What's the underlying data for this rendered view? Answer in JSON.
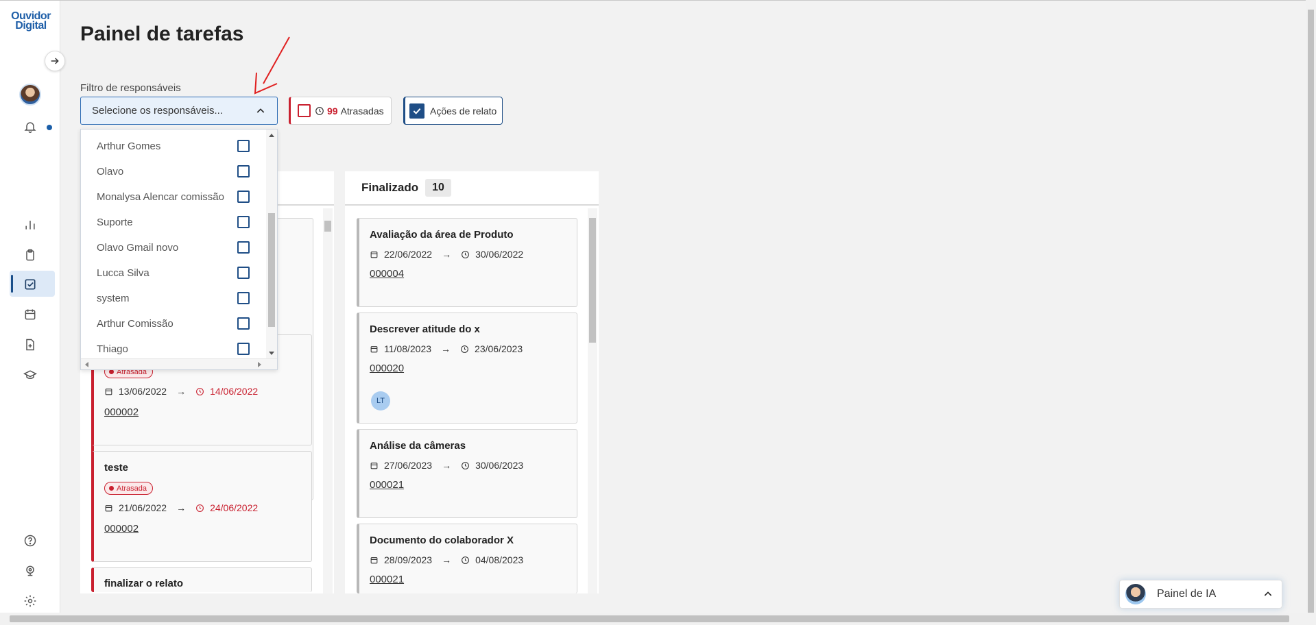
{
  "app": {
    "logo_line1": "Ouvidor",
    "logo_line2": "Digital"
  },
  "header": {
    "title": "Painel de tarefas"
  },
  "filter": {
    "label": "Filtro de responsáveis",
    "select_placeholder": "Selecione os responsáveis...",
    "options": [
      {
        "label": "Arthur Gomes",
        "checked": false
      },
      {
        "label": "Olavo",
        "checked": false
      },
      {
        "label": "Monalysa Alencar comissão",
        "checked": false
      },
      {
        "label": "Suporte",
        "checked": false
      },
      {
        "label": "Olavo Gmail novo",
        "checked": false
      },
      {
        "label": "Lucca Silva",
        "checked": false
      },
      {
        "label": "system",
        "checked": false
      },
      {
        "label": "Arthur Comissão",
        "checked": false
      },
      {
        "label": "Thiago",
        "checked": false
      }
    ]
  },
  "toggles": {
    "late": {
      "count": "99",
      "label": "Atrasadas",
      "checked": false
    },
    "actions": {
      "label": "Ações de relato",
      "checked": true
    }
  },
  "columns": {
    "left": {
      "cards": [
        {
          "badge": "Atrasada",
          "start": "13/06/2022",
          "end": "14/06/2022",
          "code": "000002"
        },
        {
          "title": "teste",
          "badge": "Atrasada",
          "start": "21/06/2022",
          "end": "24/06/2022",
          "code": "000002"
        },
        {
          "title": "finalizar o relato"
        }
      ]
    },
    "finalizado": {
      "title": "Finalizado",
      "count": "10",
      "cards": [
        {
          "title": "Avaliação da área de Produto",
          "start": "22/06/2022",
          "end": "30/06/2022",
          "code": "000004"
        },
        {
          "title": "Descrever atitude do x",
          "start": "11/08/2023",
          "end": "23/06/2023",
          "code": "000020",
          "assignee": "LT"
        },
        {
          "title": "Análise da câmeras",
          "start": "27/06/2023",
          "end": "30/06/2023",
          "code": "000021"
        },
        {
          "title": "Documento do colaborador X",
          "start": "28/09/2023",
          "end": "04/08/2023",
          "code": "000021"
        }
      ]
    }
  },
  "ai_panel": {
    "label": "Painel de IA"
  },
  "colors": {
    "primary": "#1f4e86",
    "danger": "#c9202f",
    "active_bg": "#dde9f7"
  },
  "icons": [
    "arrow-right-icon",
    "bell-icon",
    "chart-icon",
    "clipboard-icon",
    "task-check-icon",
    "calendar-icon",
    "file-plus-icon",
    "graduation-cap-icon",
    "help-icon",
    "webcam-icon",
    "gear-icon",
    "chevron-up-icon",
    "clock-icon"
  ]
}
